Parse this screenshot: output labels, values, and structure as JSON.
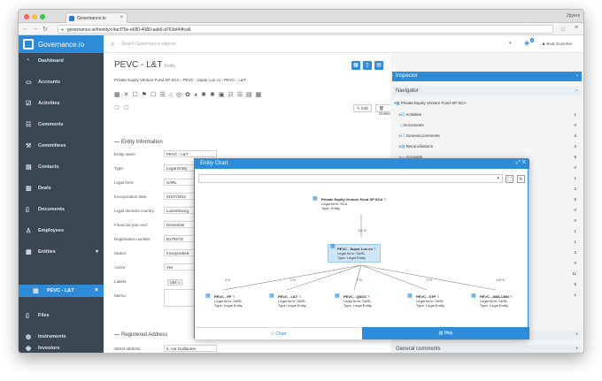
{
  "browser": {
    "tab_title": "Governance.io",
    "profile": "2pyers",
    "url": "governance.io/#entity/c4acf75e-e680-4080-aab6-d763ef44fca6"
  },
  "app": {
    "logo_text": "Governance.io",
    "search_placeholder": "Search Governance objects",
    "notification_count": "3",
    "user_name": "Beat Gusmhar"
  },
  "sidebar": {
    "items": [
      {
        "label": "Dashboard",
        "icon": "dashboard-icon"
      },
      {
        "label": "Accounts",
        "icon": "accounts-icon"
      },
      {
        "label": "Activities",
        "icon": "activities-icon"
      },
      {
        "label": "Comments",
        "icon": "comments-icon"
      },
      {
        "label": "Committees",
        "icon": "committees-icon"
      },
      {
        "label": "Contacts",
        "icon": "contacts-icon"
      },
      {
        "label": "Deals",
        "icon": "deals-icon"
      },
      {
        "label": "Documents",
        "icon": "documents-icon"
      },
      {
        "label": "Employees",
        "icon": "employees-icon"
      },
      {
        "label": "Entities",
        "icon": "entities-icon"
      },
      {
        "label": "PEVC - L&T",
        "icon": "entity-icon"
      },
      {
        "label": "Files",
        "icon": "files-icon"
      },
      {
        "label": "Instruments",
        "icon": "instruments-icon"
      },
      {
        "label": "Investors",
        "icon": "investors-icon"
      }
    ]
  },
  "entity": {
    "title": "PEVC - L&T",
    "subtitle": "Entity",
    "breadcrumb": [
      "Private Equity Venture Fund SP SCA",
      "PEVC - Super Lux co",
      "PEVC - L&T"
    ],
    "edit_label": "Edit",
    "delete_label": "Delete",
    "info_section": "Entity Information",
    "fields": [
      {
        "label": "Entity name:",
        "value": "PEVC - L&T"
      },
      {
        "label": "Type:",
        "value": "Legal Entity"
      },
      {
        "label": "Legal form:",
        "value": "SARL"
      },
      {
        "label": "Incorporation date:",
        "value": "01/07/2011"
      },
      {
        "label": "Legal domicile country:",
        "value": "Luxembourg"
      },
      {
        "label": "Financial year end:",
        "value": "December"
      },
      {
        "label": "Registration number:",
        "value": "B17927G"
      },
      {
        "label": "Status:",
        "value": "Incorporated"
      },
      {
        "label": "Active:",
        "value": "Yes"
      },
      {
        "label": "Labels:",
        "value": ""
      },
      {
        "label": "Memo:",
        "value": ""
      }
    ],
    "label_tag": "CBT",
    "address_section": "Registered Address",
    "street_label": "Street address:",
    "street_value": "5, rue Guillaume"
  },
  "inspector": {
    "title": "Inspector",
    "navigator_title": "Navigator",
    "root": "Private Equity Venture Fund SP SCA",
    "items": [
      {
        "label": "Activities",
        "count": "1"
      },
      {
        "label": "Documents",
        "count": "0"
      },
      {
        "label": "General comments",
        "count": "3"
      },
      {
        "label": "Reconciliations",
        "count": "2"
      },
      {
        "label": "Accounts",
        "count": "5"
      }
    ],
    "extra_counts": [
      "0",
      "1",
      "2",
      "6",
      "0",
      "0",
      "1",
      "1",
      "2",
      "0",
      "11",
      "5",
      "1"
    ],
    "footer_label": "General comments"
  },
  "entity_chart": {
    "title": "Entity Chart",
    "tab_chart": "Chart",
    "tab_map": "Map",
    "root": {
      "name": "Private Equity Venture Fund SP SCA",
      "legal_form": "Legal form: SCA",
      "type": "Type: Entity"
    },
    "root_pct": "100 %",
    "middle": {
      "name": "PEVC - Super Lux co",
      "legal_form": "Legal form: SARL",
      "type": "Type: Legal Entity"
    },
    "children": [
      {
        "name": "PEVC - FF",
        "legal_form": "Legal form: SARL",
        "type": "Type: Legal Entity",
        "pct": "0 %"
      },
      {
        "name": "PEVC - L&T",
        "legal_form": "Legal form: SARL",
        "type": "Type: Legal Entity",
        "pct": "0 %"
      },
      {
        "name": "PEVC - QSOC",
        "legal_form": "Legal form: SARL",
        "type": "Type: Legal Entity",
        "pct": "0 %"
      },
      {
        "name": "PEVC - STP",
        "legal_form": "Legal form: SARL",
        "type": "Type: Legal Entity",
        "pct": "0 %"
      },
      {
        "name": "PEVC - ABS-CBN",
        "legal_form": "Legal form: SARL",
        "type": "Type: Legal Entity",
        "pct": "100 %"
      }
    ]
  }
}
